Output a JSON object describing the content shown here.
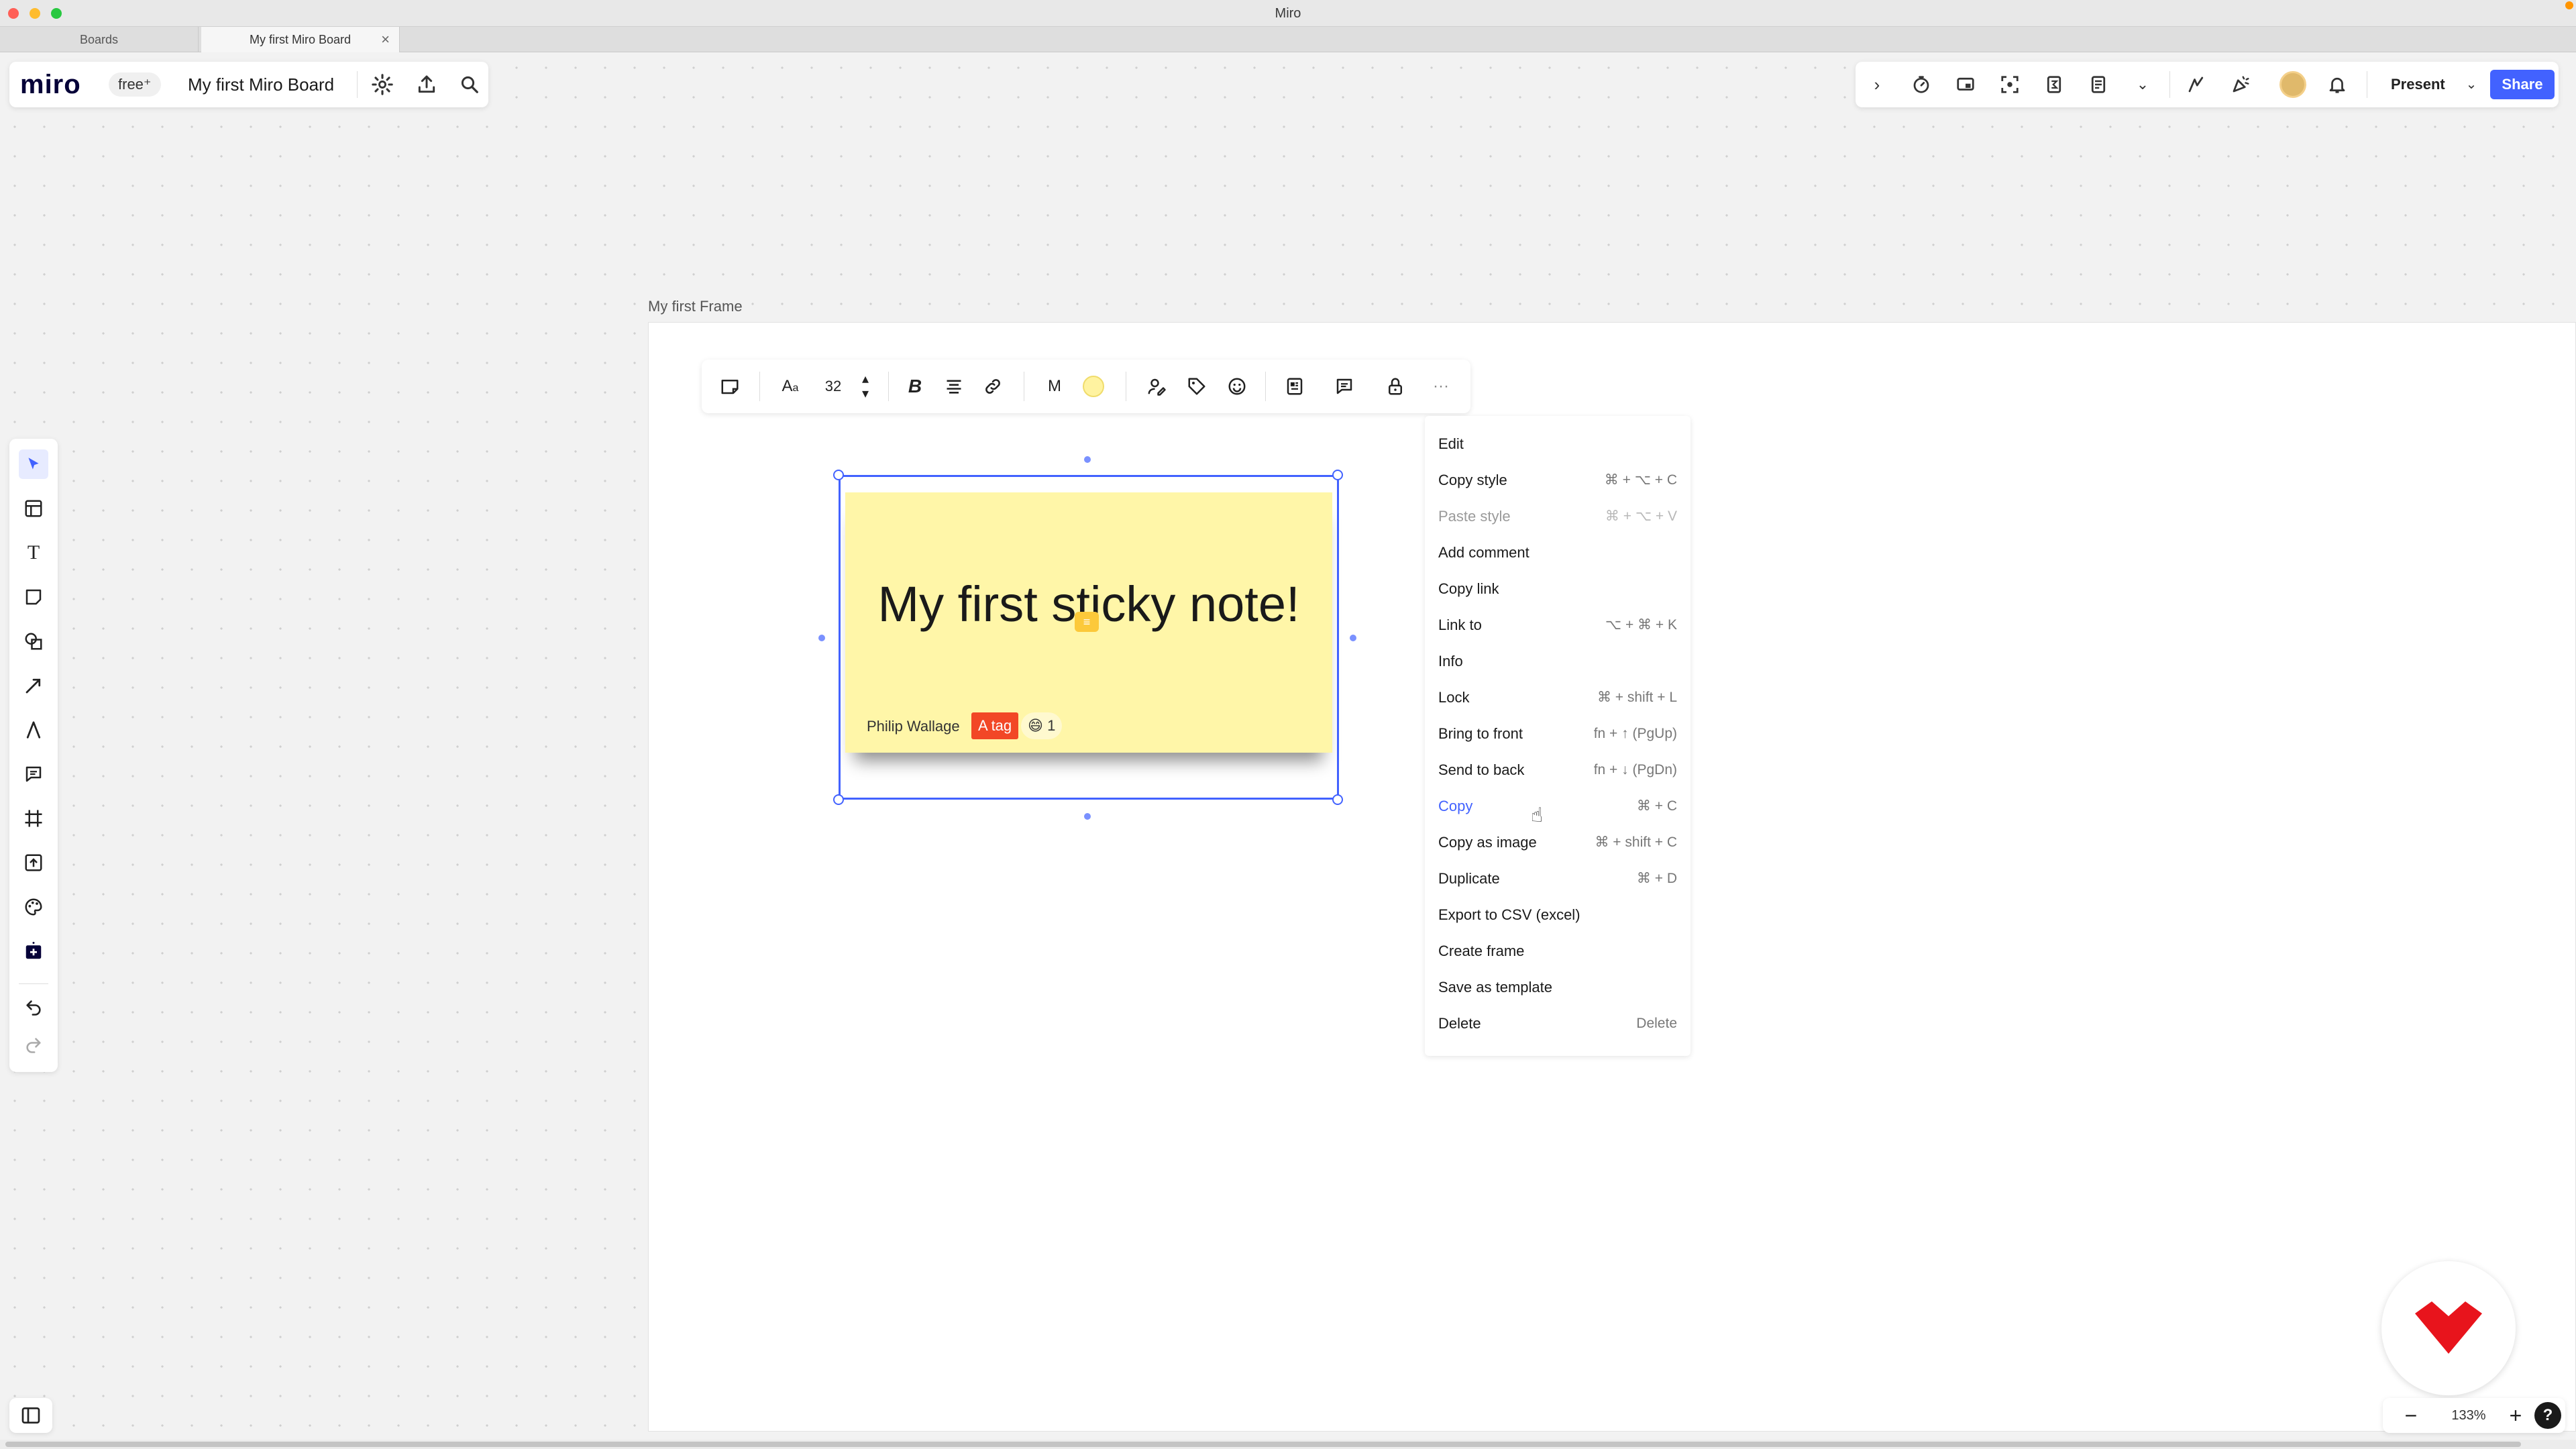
{
  "window": {
    "title": "Miro"
  },
  "browser_tabs": [
    {
      "label": "Boards"
    },
    {
      "label": "My first Miro Board",
      "close": "×"
    }
  ],
  "header": {
    "logo": "miro",
    "plan": "free⁺",
    "board_title": "My first Miro Board",
    "icons": [
      "gear-icon",
      "upload-icon",
      "search-icon"
    ]
  },
  "top_right": {
    "icons": [
      "chevron-right-icon",
      "timer-icon",
      "screen-share-icon",
      "focus-icon",
      "formula-icon",
      "notes-icon",
      "more-chevron-icon",
      "reactions-icon",
      "celebrate-icon",
      "avatar",
      "bell-icon"
    ],
    "present_label": "Present",
    "present_caret": "⌄",
    "share_label": "Share"
  },
  "frame": {
    "label": "My first Frame"
  },
  "context_toolbar": {
    "font_size": "32",
    "text_style": "M",
    "selected_color": "#fff3a0",
    "more": "···"
  },
  "sticky_note": {
    "text": "My first sticky note!",
    "author": "Philip Wallage",
    "tag": "A tag",
    "reaction_emoji": "😄",
    "reaction_count": "1",
    "color": "#fff6a8"
  },
  "context_menu": {
    "items": [
      {
        "label": "Edit",
        "shortcut": ""
      },
      {
        "label": "Copy style",
        "shortcut": "⌘ + ⌥ + C"
      },
      {
        "label": "Paste style",
        "shortcut": "⌘ + ⌥ + V",
        "disabled": true
      },
      {
        "label": "Add comment",
        "shortcut": ""
      },
      {
        "label": "Copy link",
        "shortcut": ""
      },
      {
        "label": "Link to",
        "shortcut": "⌥ + ⌘ + K"
      },
      {
        "label": "Info",
        "shortcut": ""
      },
      {
        "label": "Lock",
        "shortcut": "⌘ + shift + L"
      },
      {
        "label": "Bring to front",
        "shortcut": "fn + ↑ (PgUp)"
      },
      {
        "label": "Send to back",
        "shortcut": "fn + ↓ (PgDn)"
      },
      {
        "label": "Copy",
        "shortcut": "⌘ + C",
        "hovered": true
      },
      {
        "label": "Copy as image",
        "shortcut": "⌘ + shift + C"
      },
      {
        "label": "Duplicate",
        "shortcut": "⌘ + D"
      },
      {
        "label": "Export to CSV (excel)",
        "shortcut": ""
      },
      {
        "label": "Create frame",
        "shortcut": ""
      },
      {
        "label": "Save as template",
        "shortcut": ""
      },
      {
        "label": "Delete",
        "shortcut": "Delete"
      }
    ]
  },
  "zoom": {
    "value": "133%",
    "minus": "−",
    "plus": "+",
    "help": "?"
  },
  "colors": {
    "accent": "#4262ff",
    "tag": "#f24726",
    "brand_badge": "#e8141c"
  }
}
